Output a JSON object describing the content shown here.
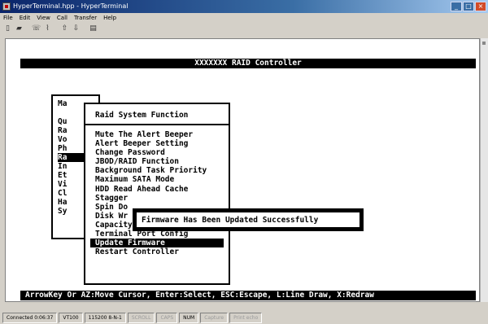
{
  "window": {
    "title": "HyperTerminal.hpp - HyperTerminal",
    "buttons": [
      "_",
      "□",
      "×"
    ]
  },
  "menubar": [
    "File",
    "Edit",
    "View",
    "Call",
    "Transfer",
    "Help"
  ],
  "toolbar": [
    "new-icon",
    "open-icon",
    "phone-icon",
    "disconnect-icon",
    "send-icon",
    "receive-icon",
    "properties-icon"
  ],
  "terminal": {
    "header": "XXXXXXX RAID Controller",
    "footer": "ArrowKey Or AZ:Move Cursor, Enter:Select, ESC:Escape, L:Line Draw, X:Redraw",
    "main_menu": {
      "title": "Ma",
      "items": [
        "Qu",
        "Ra",
        "Vo",
        "Ph",
        "Ra",
        "In",
        "Et",
        "Vi",
        "Cl",
        "Ha",
        "Sy"
      ],
      "selected_index": 4
    },
    "submenu": {
      "title": "Raid System Function",
      "items": [
        "Mute The Alert Beeper",
        "Alert Beeper Setting",
        "Change Password",
        "JBOD/RAID Function",
        "Background Task Priority",
        "Maximum SATA Mode",
        "HDD Read Ahead Cache",
        "Stagger",
        "Spin Do",
        "Disk Wr",
        "Capacity Truncation",
        "Terminal Port Config",
        "Update Firmware",
        "Restart Controller"
      ],
      "selected_index": 12
    },
    "popup": "Firmware Has Been Updated Successfully"
  },
  "statusbar": {
    "connected": "Connected 0:06:37",
    "emulation": "VT100",
    "settings": "115200 8-N-1",
    "scroll": "SCROLL",
    "caps": "CAPS",
    "num": "NUM",
    "capture": "Capture",
    "print_echo": "Print echo"
  }
}
